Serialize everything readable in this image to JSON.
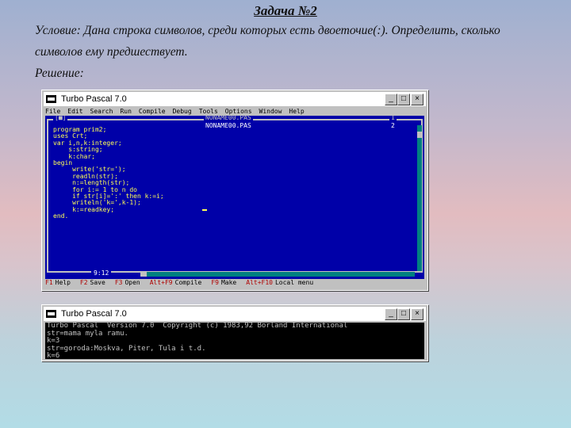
{
  "slide": {
    "title": "Задача №2",
    "condition_line1": "Условие: Дана строка символов, среди которых есть двоеточие(:). Определить, сколько",
    "condition_line2": "символов ему предшествует.",
    "solution_label": "Решение:"
  },
  "ide_window": {
    "title": "Turbo Pascal 7.0",
    "menu": [
      "File",
      "Edit",
      "Search",
      "Run",
      "Compile",
      "Debug",
      "Tools",
      "Options",
      "Window",
      "Help"
    ],
    "tabs": [
      {
        "label": "NONAME00.PAS",
        "number": "1"
      },
      {
        "label": "NONAME00.PAS",
        "number": "2"
      }
    ],
    "code_lines": [
      "program prim2;",
      "uses Crt;",
      "var i,n,k:integer;",
      "    s:string;",
      "    k:char;",
      "begin",
      "     write('str=');",
      "     readln(str);",
      "     n:=length(str);",
      "     for i:= 1 to n do",
      "     if str[i]=':' then k:=i;",
      "     writeln('k=',k-1);",
      "     k:=readkey;",
      "end."
    ],
    "cursor_position": "9:12",
    "status_items": [
      {
        "key": "F1",
        "label": "Help"
      },
      {
        "key": "F2",
        "label": "Save"
      },
      {
        "key": "F3",
        "label": "Open"
      },
      {
        "key": "Alt+F9",
        "label": "Compile"
      },
      {
        "key": "F9",
        "label": "Make"
      },
      {
        "key": "Alt+F10",
        "label": "Local menu"
      }
    ]
  },
  "output_window": {
    "title": "Turbo Pascal 7.0",
    "lines": [
      "Turbo Pascal  Version 7.0  Copyright (c) 1983,92 Borland International",
      "str=mama myla ramu.",
      "k=3",
      "str=goroda:Moskva, Piter, Tula i t.d.",
      "k=6"
    ]
  },
  "title_buttons": {
    "minimize": "_",
    "maximize": "□",
    "close": "×"
  },
  "colors": {
    "ide_background": "#0000a8",
    "code_text": "#ffff55",
    "console_background": "#000000",
    "window_chrome": "#c0c0c0"
  }
}
